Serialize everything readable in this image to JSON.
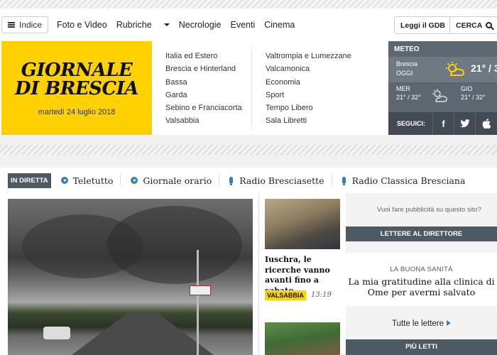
{
  "topnav": {
    "indice_label": "Indice",
    "links": [
      "Foto e Video",
      "Rubriche",
      "Necrologie",
      "Eventi",
      "Cinema"
    ],
    "gdb_button": "Leggi il GDB",
    "search_button": "CERCA"
  },
  "masthead": {
    "logo_line1": "GIORNALE",
    "logo_line2": "DI BRESCIA",
    "date": "martedì 24 luglio 2018",
    "sections_col1": [
      "Italia ed Estero",
      "Brescia e Hinterland",
      "Bassa",
      "Garda",
      "Sebino e Franciacorta",
      "Valsabbia"
    ],
    "sections_col2": [
      "Valtrompia e Lumezzane",
      "Valcamonica",
      "Economia",
      "Sport",
      "Tempo Libero",
      "Sala Libretti"
    ]
  },
  "weather": {
    "header": "METEO",
    "today_city": "Brescia",
    "today_label": "OGGI",
    "today_temp": "21° / 3",
    "day2_label": "MER",
    "day2_temp": "21° / 32°",
    "day3_label": "GIO",
    "day3_temp": "21° / 32°",
    "follow_label": "SEGUICI:",
    "social": [
      "f",
      "t",
      "a"
    ]
  },
  "live": {
    "badge": "IN DIRETTA",
    "items": [
      "Teletutto",
      "Giornale orario",
      "Radio Bresciasette",
      "Radio Classica Bresciana"
    ]
  },
  "story": {
    "title": "Iuschra, le ricerche vanno avanti fino a sabato",
    "tag": "VALSABBIA",
    "time": "13:19"
  },
  "sidebar": {
    "ad_text": "Vuoi fare pubblicità su questo sito?",
    "letters_header": "LETTERE AL DIRETTORE",
    "letter_kicker": "LA BUONA SANITÀ",
    "letter_title": "La mia gratitudine alla clinica di Ome per avermi salvato",
    "all_letters": "Tutte le lettere",
    "most_read": "PIÙ LETTI"
  }
}
